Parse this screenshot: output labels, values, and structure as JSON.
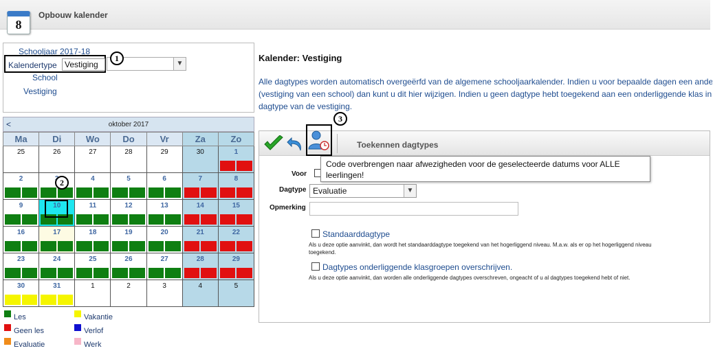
{
  "header": {
    "title": "Opbouw kalender",
    "icon_day": "8"
  },
  "tree": {
    "schooljaar": "Schooljaar 2017-18",
    "kalendertype_label": "Kalendertype",
    "kalendertype_value": "Vestiging",
    "school": "School",
    "vestiging": "Vestiging"
  },
  "markers": {
    "m1": "1",
    "m2": "2",
    "m3": "3"
  },
  "calendar": {
    "nav_prev": "<",
    "month": "oktober 2017",
    "weekdays": [
      "Ma",
      "Di",
      "Wo",
      "Do",
      "Vr",
      "Za",
      "Zo"
    ],
    "weeks": [
      [
        {
          "d": "25",
          "in": false,
          "we": false,
          "bars": ""
        },
        {
          "d": "26",
          "in": false,
          "we": false,
          "bars": ""
        },
        {
          "d": "27",
          "in": false,
          "we": false,
          "bars": ""
        },
        {
          "d": "28",
          "in": false,
          "we": false,
          "bars": ""
        },
        {
          "d": "29",
          "in": false,
          "we": false,
          "bars": ""
        },
        {
          "d": "30",
          "in": false,
          "we": true,
          "bars": ""
        },
        {
          "d": "1",
          "in": true,
          "we": true,
          "bars": "geen"
        }
      ],
      [
        {
          "d": "2",
          "in": true,
          "we": false,
          "bars": "les"
        },
        {
          "d": "3",
          "in": true,
          "we": false,
          "bars": "les"
        },
        {
          "d": "4",
          "in": true,
          "we": false,
          "bars": "les"
        },
        {
          "d": "5",
          "in": true,
          "we": false,
          "bars": "les"
        },
        {
          "d": "6",
          "in": true,
          "we": false,
          "bars": "les"
        },
        {
          "d": "7",
          "in": true,
          "we": true,
          "bars": "geen"
        },
        {
          "d": "8",
          "in": true,
          "we": true,
          "bars": "geen"
        }
      ],
      [
        {
          "d": "9",
          "in": true,
          "we": false,
          "bars": "les"
        },
        {
          "d": "10",
          "in": true,
          "we": false,
          "bars": "les",
          "sel": true
        },
        {
          "d": "11",
          "in": true,
          "we": false,
          "bars": "les"
        },
        {
          "d": "12",
          "in": true,
          "we": false,
          "bars": "les"
        },
        {
          "d": "13",
          "in": true,
          "we": false,
          "bars": "les"
        },
        {
          "d": "14",
          "in": true,
          "we": true,
          "bars": "geen"
        },
        {
          "d": "15",
          "in": true,
          "we": true,
          "bars": "geen"
        }
      ],
      [
        {
          "d": "16",
          "in": true,
          "we": false,
          "bars": "les"
        },
        {
          "d": "17",
          "in": true,
          "we": false,
          "bars": "les",
          "today": true
        },
        {
          "d": "18",
          "in": true,
          "we": false,
          "bars": "les"
        },
        {
          "d": "19",
          "in": true,
          "we": false,
          "bars": "les"
        },
        {
          "d": "20",
          "in": true,
          "we": false,
          "bars": "les"
        },
        {
          "d": "21",
          "in": true,
          "we": true,
          "bars": "geen"
        },
        {
          "d": "22",
          "in": true,
          "we": true,
          "bars": "geen"
        }
      ],
      [
        {
          "d": "23",
          "in": true,
          "we": false,
          "bars": "les"
        },
        {
          "d": "24",
          "in": true,
          "we": false,
          "bars": "les"
        },
        {
          "d": "25",
          "in": true,
          "we": false,
          "bars": "les"
        },
        {
          "d": "26",
          "in": true,
          "we": false,
          "bars": "les"
        },
        {
          "d": "27",
          "in": true,
          "we": false,
          "bars": "les"
        },
        {
          "d": "28",
          "in": true,
          "we": true,
          "bars": "geen"
        },
        {
          "d": "29",
          "in": true,
          "we": true,
          "bars": "geen"
        }
      ],
      [
        {
          "d": "30",
          "in": true,
          "we": false,
          "bars": "vak"
        },
        {
          "d": "31",
          "in": true,
          "we": false,
          "bars": "vak"
        },
        {
          "d": "1",
          "in": false,
          "we": false,
          "bars": ""
        },
        {
          "d": "2",
          "in": false,
          "we": false,
          "bars": ""
        },
        {
          "d": "3",
          "in": false,
          "we": false,
          "bars": ""
        },
        {
          "d": "4",
          "in": false,
          "we": true,
          "bars": ""
        },
        {
          "d": "5",
          "in": false,
          "we": true,
          "bars": ""
        }
      ]
    ]
  },
  "legend": [
    {
      "label": "Les",
      "color": "#0f7f12"
    },
    {
      "label": "Vakantie",
      "color": "#f5f500"
    },
    {
      "label": "Geen les",
      "color": "#e11010"
    },
    {
      "label": "Verlof",
      "color": "#1010d0"
    },
    {
      "label": "Evaluatie",
      "color": "#f08c1a"
    },
    {
      "label": "Werk",
      "color": "#f7b6c8"
    }
  ],
  "right": {
    "title": "Kalender: Vestiging",
    "desc_lines": [
      "Alle dagtypes worden automatisch overgeërfd van de algemene schooljaarkalender. Indien u voor bepaalde dagen een ander",
      "(vestiging van een school) dan kunt u dit hier wijzigen. Indien u geen dagtype hebt toegekend aan een onderliggende klas in",
      "dagtype van de vestiging."
    ],
    "toolbar_title": "Toekennen dagtypes",
    "tooltip": "Code overbrengen naar afwezigheden voor de geselecteerde datums voor ALLE leerlingen!",
    "voor_label": "Voor",
    "dagtype_label": "Dagtype",
    "dagtype_value": "Evaluatie",
    "opmerking_label": "Opmerking",
    "opmerking_value": "",
    "opt1_label": "Standaarddagtype",
    "opt1_help": "Als u deze optie aanvinkt, dan wordt het standaarddagtype toegekend van het hogerliggend niveau. M.a.w. als er op het hogerliggend niveau",
    "opt1_help2": "toegekend.",
    "opt2_label": "Dagtypes onderliggende klasgroepen overschrijven.",
    "opt2_help": "Als u deze optie aanvinkt, dan worden alle onderliggende dagtypes overschreven, ongeacht of u al dagtypes toegekend hebt of niet."
  }
}
